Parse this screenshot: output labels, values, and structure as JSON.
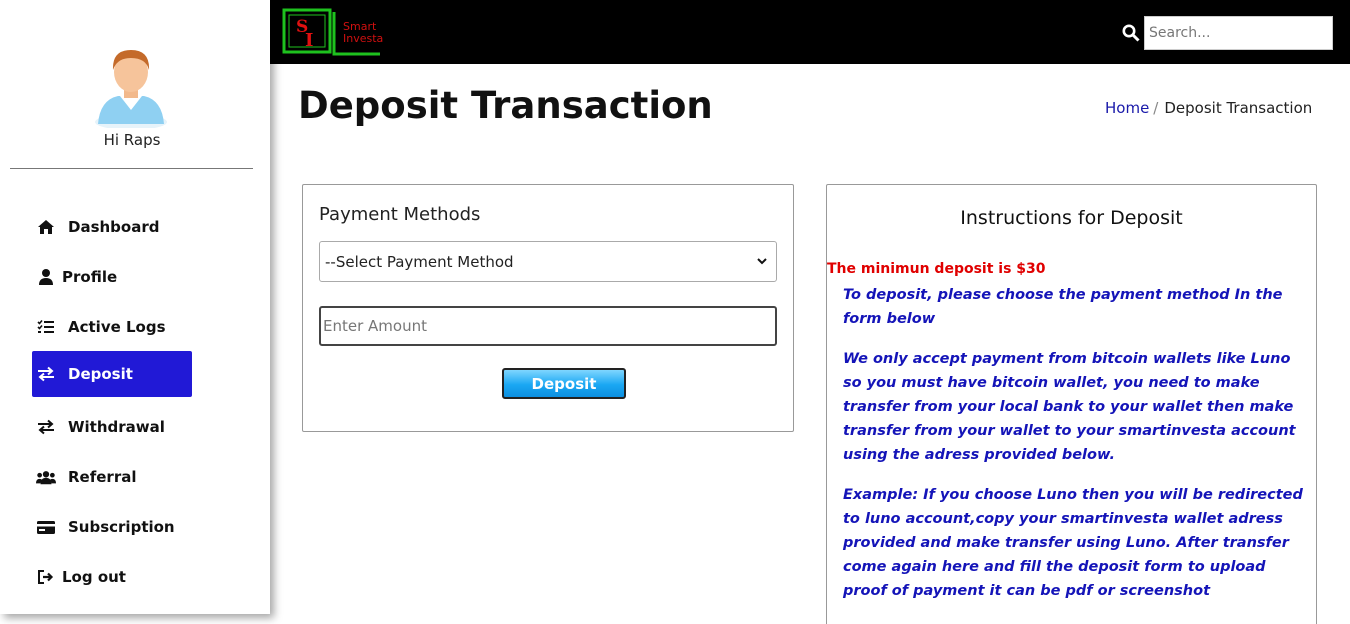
{
  "user": {
    "greeting": "Hi Raps"
  },
  "nav": {
    "items": [
      {
        "label": "Dashboard",
        "icon": "home-icon"
      },
      {
        "label": "Profile",
        "icon": "user-icon"
      },
      {
        "label": "Active Logs",
        "icon": "list-check-icon"
      },
      {
        "label": "Deposit",
        "icon": "exchange-icon"
      },
      {
        "label": "Withdrawal",
        "icon": "exchange-icon"
      },
      {
        "label": "Referral",
        "icon": "users-icon"
      },
      {
        "label": "Subscription",
        "icon": "credit-card-icon"
      },
      {
        "label": "Log out",
        "icon": "sign-out-icon"
      }
    ],
    "active": "Deposit",
    "active_color": "#2119d6"
  },
  "topbar": {
    "logo_line1": "Smart",
    "logo_line2": "Investa",
    "search_placeholder": "Search..."
  },
  "header": {
    "title": "Deposit Transaction",
    "breadcrumb_home": "Home",
    "breadcrumb_separator": "/",
    "breadcrumb_current": "Deposit Transaction"
  },
  "payment": {
    "title": "Payment Methods",
    "select_value": "--Select Payment Method",
    "amount_placeholder": "Enter Amount",
    "submit_label": "Deposit"
  },
  "instructions": {
    "title": "Instructions for Deposit",
    "min_deposit": "The minimun deposit is $30",
    "p1": "To deposit, please choose the payment method In the form below",
    "p2": "We only accept payment from bitcoin wallets like Luno so you must have bitcoin wallet, you need to make transfer from your local bank to your wallet then make transfer from your wallet to your smartinvesta account using the adress provided below.",
    "p3": "Example: If you choose Luno then you will be redirected to luno account,copy your smartinvesta wallet adress provided and make transfer using Luno. After transfer come again here and fill the deposit form to upload proof of payment it can be pdf or screenshot"
  },
  "colors": {
    "topbar": "#000000",
    "link": "#1a1aaa",
    "warning": "#e00000",
    "instruction_text": "#1414b8"
  }
}
